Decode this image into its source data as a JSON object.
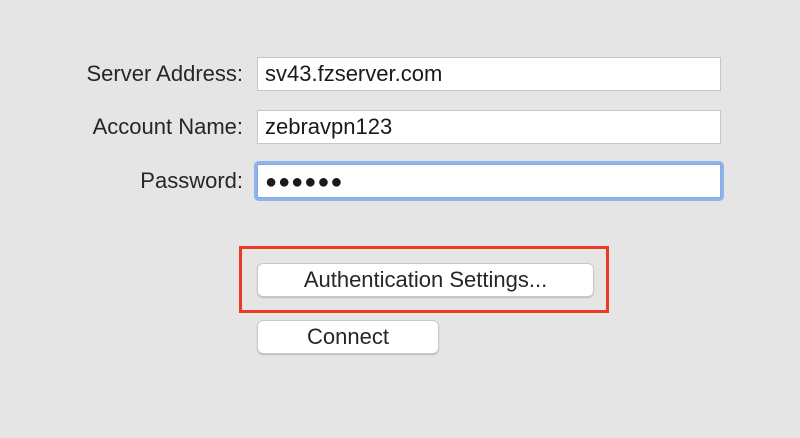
{
  "form": {
    "server_address": {
      "label": "Server Address:",
      "value": "sv43.fzserver.com"
    },
    "account_name": {
      "label": "Account Name:",
      "value": "zebravpn123"
    },
    "password": {
      "label": "Password:",
      "masked_value": "●●●●●●"
    }
  },
  "buttons": {
    "authentication_settings": "Authentication Settings...",
    "connect": "Connect"
  },
  "colors": {
    "highlight_box": "#e83b22",
    "focus_ring": "#8fb3ec",
    "background": "#e5e5e5"
  }
}
